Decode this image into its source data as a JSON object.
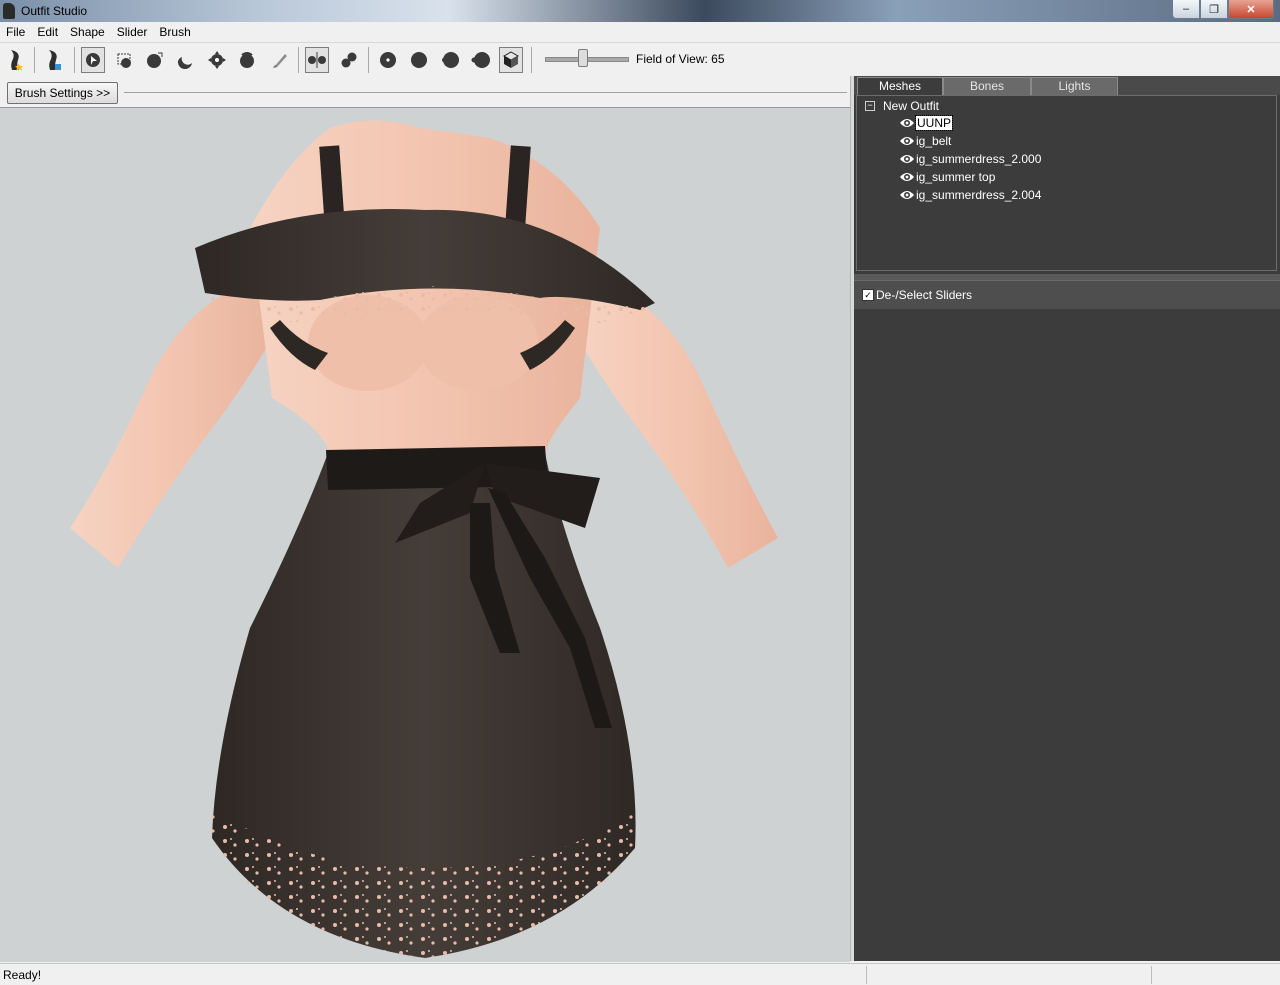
{
  "window": {
    "title": "Outfit Studio",
    "close_label": "✕",
    "restore_label": "❐",
    "minimize_label": "–"
  },
  "menu": [
    "File",
    "Edit",
    "Shape",
    "Slider",
    "Brush"
  ],
  "toolbar": {
    "fov_label": "Field of View: 65",
    "fov_value": 65
  },
  "left": {
    "brush_settings_label": "Brush Settings >>"
  },
  "right": {
    "tabs": [
      "Meshes",
      "Bones",
      "Lights"
    ],
    "active_tab": "Meshes",
    "tree_root": "New Outfit",
    "meshes": [
      "UUNP",
      "ig_belt",
      "ig_summerdress_2.000",
      "ig_summer top",
      "ig_summerdress_2.004"
    ],
    "selected_mesh": "UUNP",
    "sliders_toggle_label": "De-/Select Sliders",
    "sliders_checked": true
  },
  "status": {
    "text": "Ready!"
  },
  "colors": {
    "viewport_bg": "#cfd2d3",
    "panel_bg": "#3c3c3c",
    "skin": "#f2c7b4",
    "dress": "#3f3834"
  }
}
